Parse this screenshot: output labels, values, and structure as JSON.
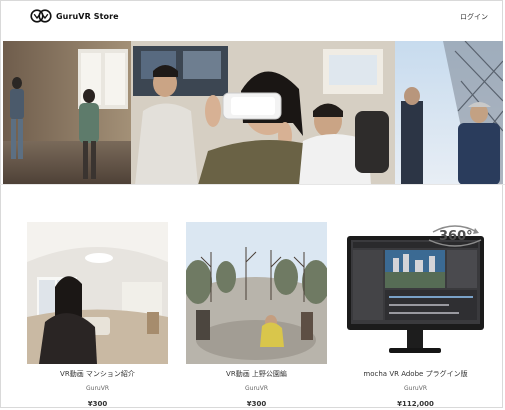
{
  "header": {
    "logo_text": "GuruVR Store",
    "logo_icon": "guruvr-logo",
    "login_label": "ログイン"
  },
  "hero": {
    "image": "people-trying-vr-headsets-photo"
  },
  "products": [
    {
      "title": "VR動画 マンション紹介",
      "seller": "GuruVR",
      "price": "¥300",
      "thumb": "360-apartment-woman"
    },
    {
      "title": "VR動画 上野公園編",
      "seller": "GuruVR",
      "price": "¥300",
      "thumb": "360-ueno-park"
    },
    {
      "title": "mocha VR Adobe プラグイン版",
      "seller": "GuruVR",
      "price": "¥112,000",
      "thumb": "monitor-360-software",
      "badge": "360°"
    }
  ],
  "colors": {
    "accent": "#111111",
    "text": "#333333",
    "muted": "#666666"
  }
}
